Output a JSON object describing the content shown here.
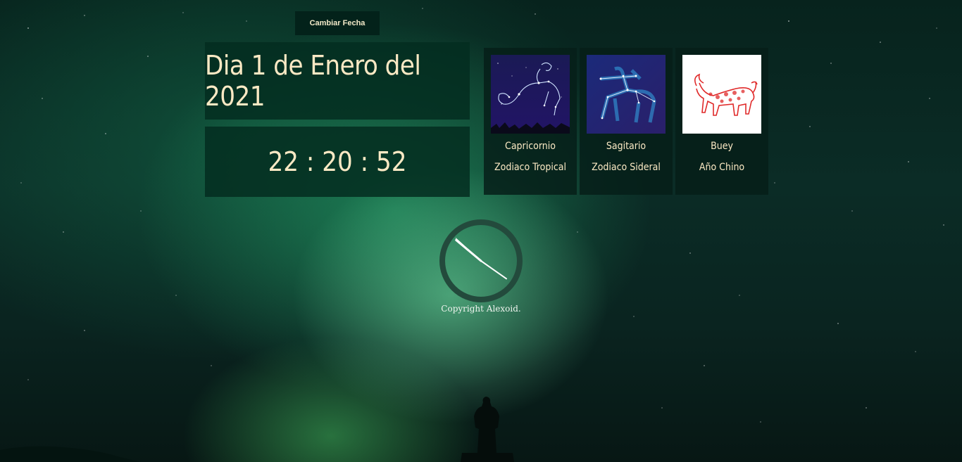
{
  "header": {
    "change_date_label": "Cambiar Fecha"
  },
  "date": {
    "text": "Dia 1 de Enero del 2021"
  },
  "time": {
    "text": "22 : 20 : 52",
    "hours": 22,
    "minutes": 20,
    "seconds": 52
  },
  "zodiac": [
    {
      "name": "Capricornio",
      "type": "Zodiaco Tropical",
      "icon": "capricorn-constellation-image"
    },
    {
      "name": "Sagitario",
      "type": "Zodiaco Sideral",
      "icon": "sagittarius-constellation-image"
    },
    {
      "name": "Buey",
      "type": "Año Chino",
      "icon": "ox-image"
    }
  ],
  "footer": {
    "copyright": "Copyright Alexoid."
  },
  "colors": {
    "accent_text": "#fbe9c4",
    "panel": "#042d20",
    "ox_red": "#e02a2a"
  }
}
